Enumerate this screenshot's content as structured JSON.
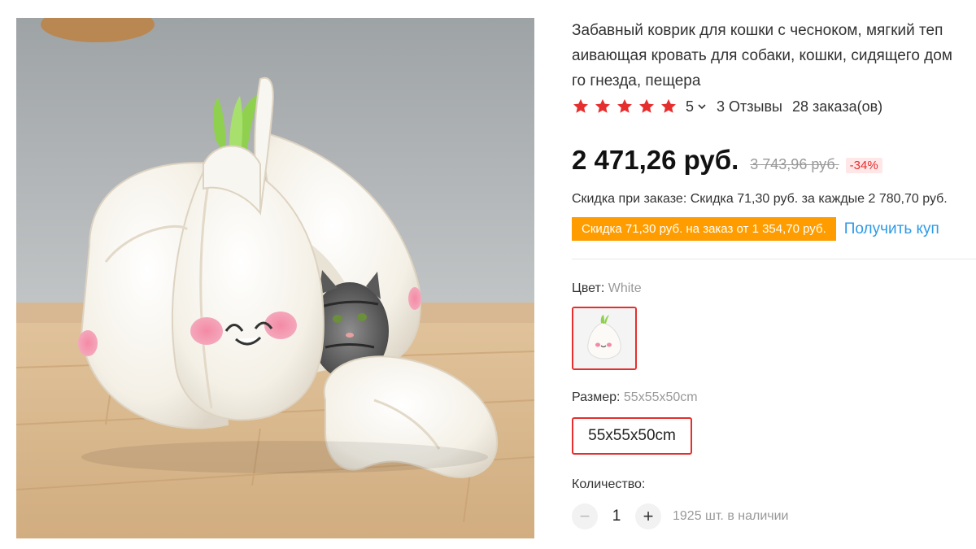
{
  "product": {
    "title_lines": [
      "Забавный коврик для кошки с чесноком, мягкий теп",
      "аивающая кровать для собаки, кошки, сидящего дом",
      "го гнезда, пещера"
    ],
    "image_alt": "garlic-cat-bed-photo"
  },
  "rating": {
    "stars_filled": 5,
    "stars_total": 5,
    "score": "5",
    "reviews": "3 Отзывы",
    "orders": "28 заказа(ов)",
    "star_color": "#e62e2e"
  },
  "price": {
    "current": "2 471,26 руб.",
    "old": "3 743,96 руб.",
    "discount": "-34%"
  },
  "promo": {
    "order_discount": "Скидка при заказе: Скидка 71,30 руб. за каждые 2 780,70 руб.",
    "coupon_tag": "Скидка 71,30 руб. на заказ от 1 354,70 руб.",
    "get_coupon": "Получить куп",
    "coupon_color": "#ff9d00",
    "link_color": "#2d9ae8"
  },
  "color": {
    "label": "Цвет:",
    "value": "White"
  },
  "size": {
    "label": "Размер:",
    "value": "55x55x50cm",
    "option": "55x55x50cm"
  },
  "quantity": {
    "label": "Количество:",
    "minus": "−",
    "value": "1",
    "plus": "+",
    "stock": "1925 шт. в наличии"
  },
  "accent_color": "#e62e2e"
}
